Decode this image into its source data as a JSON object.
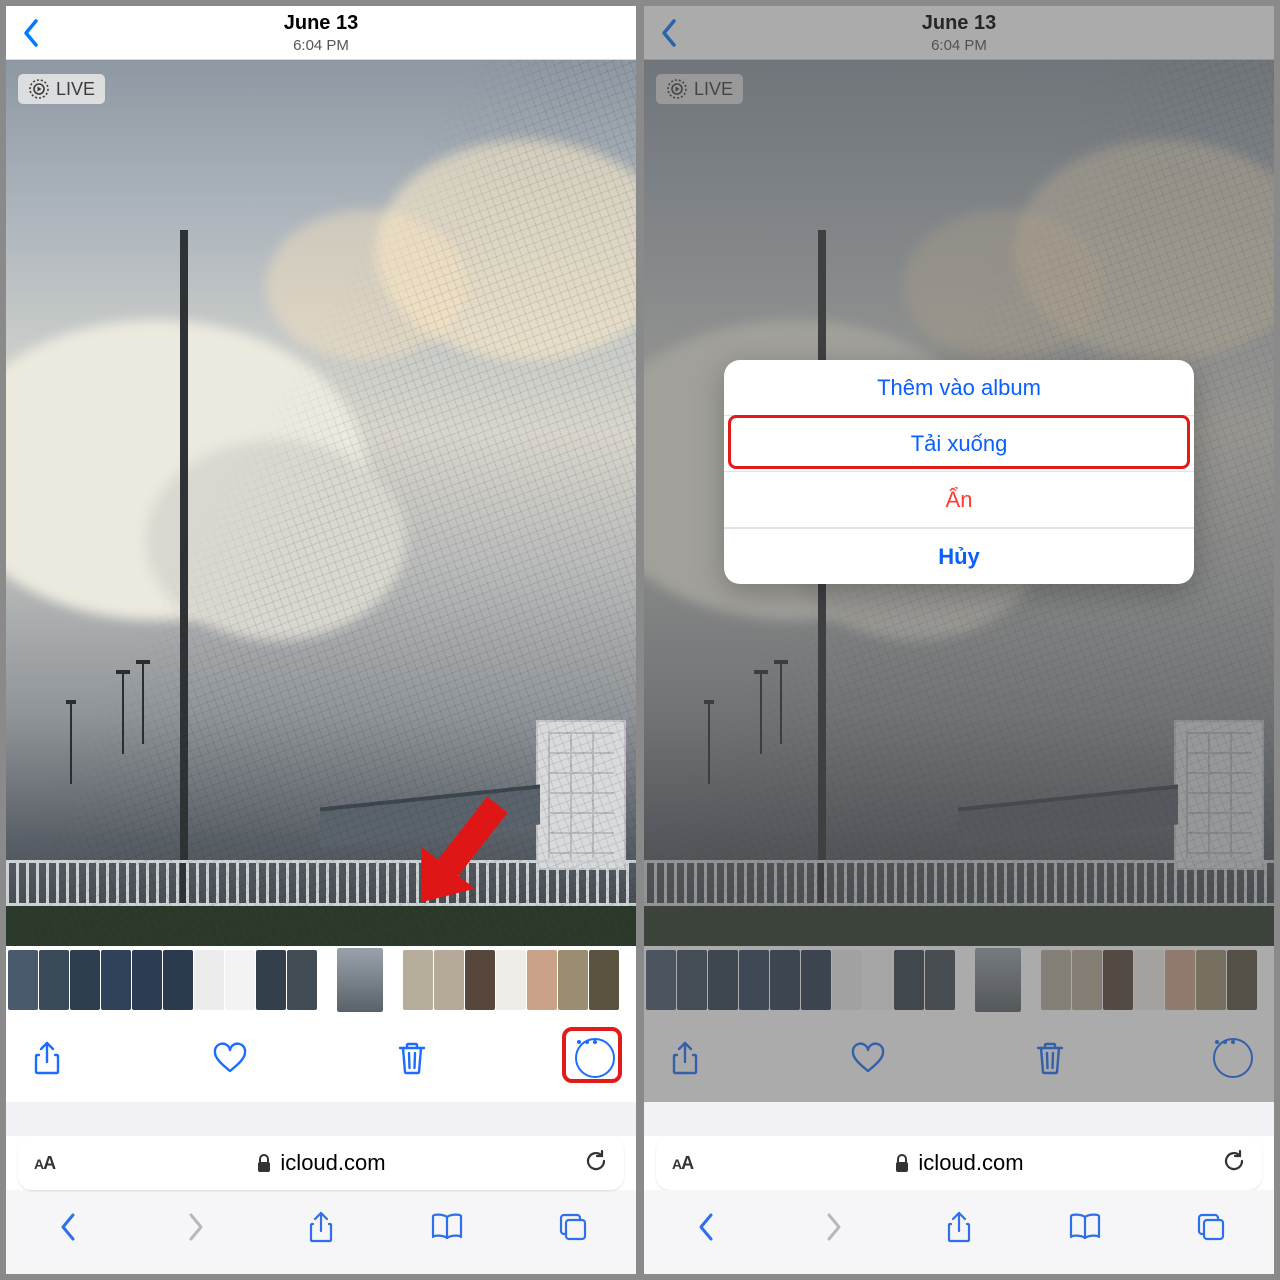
{
  "header": {
    "date": "June 13",
    "time": "6:04 PM"
  },
  "live_badge": "LIVE",
  "browser": {
    "domain": "icloud.com",
    "reader_label": "AA"
  },
  "action_sheet": {
    "add_to_album": "Thêm vào album",
    "download": "Tải xuống",
    "hide": "Ẩn",
    "cancel": "Hủy"
  },
  "icons": {
    "back": "chevron-left-icon",
    "share": "share-icon",
    "heart": "heart-icon",
    "trash": "trash-icon",
    "more": "more-icon",
    "lock": "lock-icon",
    "reload": "reload-icon",
    "safari_back": "chevron-left-icon",
    "safari_forward": "chevron-right-icon",
    "safari_share": "share-icon",
    "safari_bookmarks": "book-icon",
    "safari_tabs": "tabs-icon",
    "live": "live-photo-icon"
  },
  "thumbnails": {
    "count": 19,
    "selected_index": 11
  },
  "colors": {
    "accent": "#1a6dff",
    "destructive": "#ff3b30",
    "highlight": "#e21a1a"
  }
}
